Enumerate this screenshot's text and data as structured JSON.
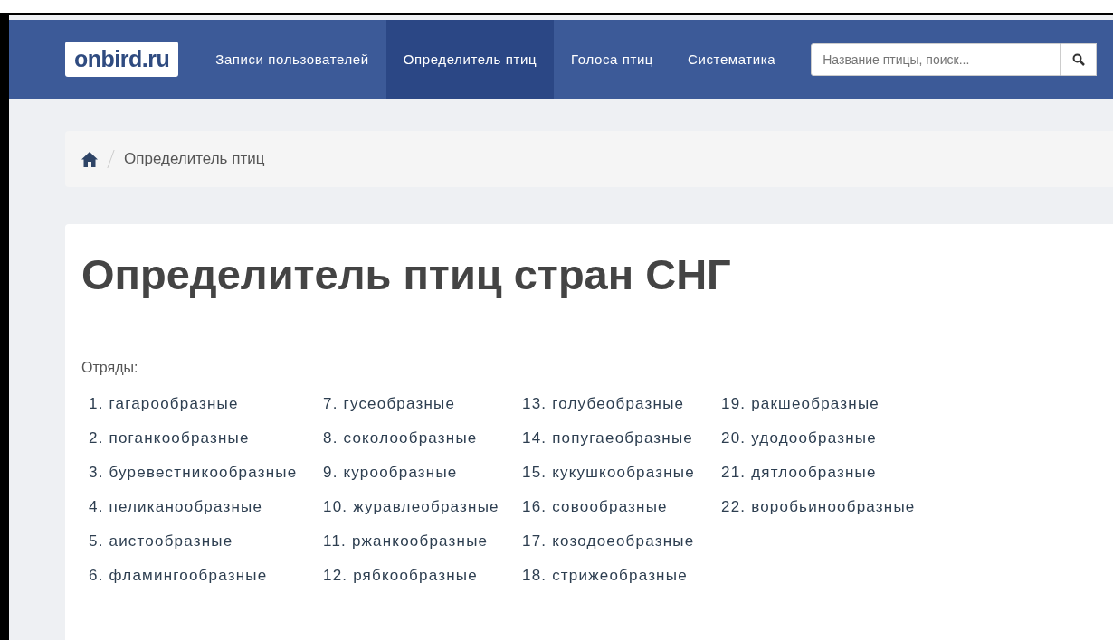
{
  "navbar": {
    "logo": "onbird.ru",
    "items": [
      {
        "label": "Записи пользователей",
        "selected": false
      },
      {
        "label": "Определитель птиц",
        "selected": true
      },
      {
        "label": "Голоса птиц",
        "selected": false
      },
      {
        "label": "Систематика",
        "selected": false
      }
    ],
    "search": {
      "placeholder": "Название птицы, поиск..."
    }
  },
  "breadcrumb": {
    "items": [
      "Определитель птиц"
    ]
  },
  "heading": "Определитель птиц стран СНГ",
  "orders": {
    "label": "Отряды:",
    "columns": [
      [
        "1. гагарообразные",
        "2. поганкообразные",
        "3. буревестникообразные",
        "4. пеликанообразные",
        "5. аистообразные",
        "6. фламингообразные"
      ],
      [
        "7. гусеобразные",
        "8. соколообразные",
        "9. курообразные",
        "10. журавлеобразные",
        "11. ржанкообразные",
        "12. рябкообразные"
      ],
      [
        "13. голубеобразные",
        "14. попугаеобразные",
        "15. кукушкообразные",
        "16. совообразные",
        "17. козодоеобразные",
        "18. стрижеобразные"
      ],
      [
        "19. ракшеобразные",
        "20. удодообразные",
        "21. дятлообразные",
        "22. воробьинообразные"
      ]
    ]
  }
}
